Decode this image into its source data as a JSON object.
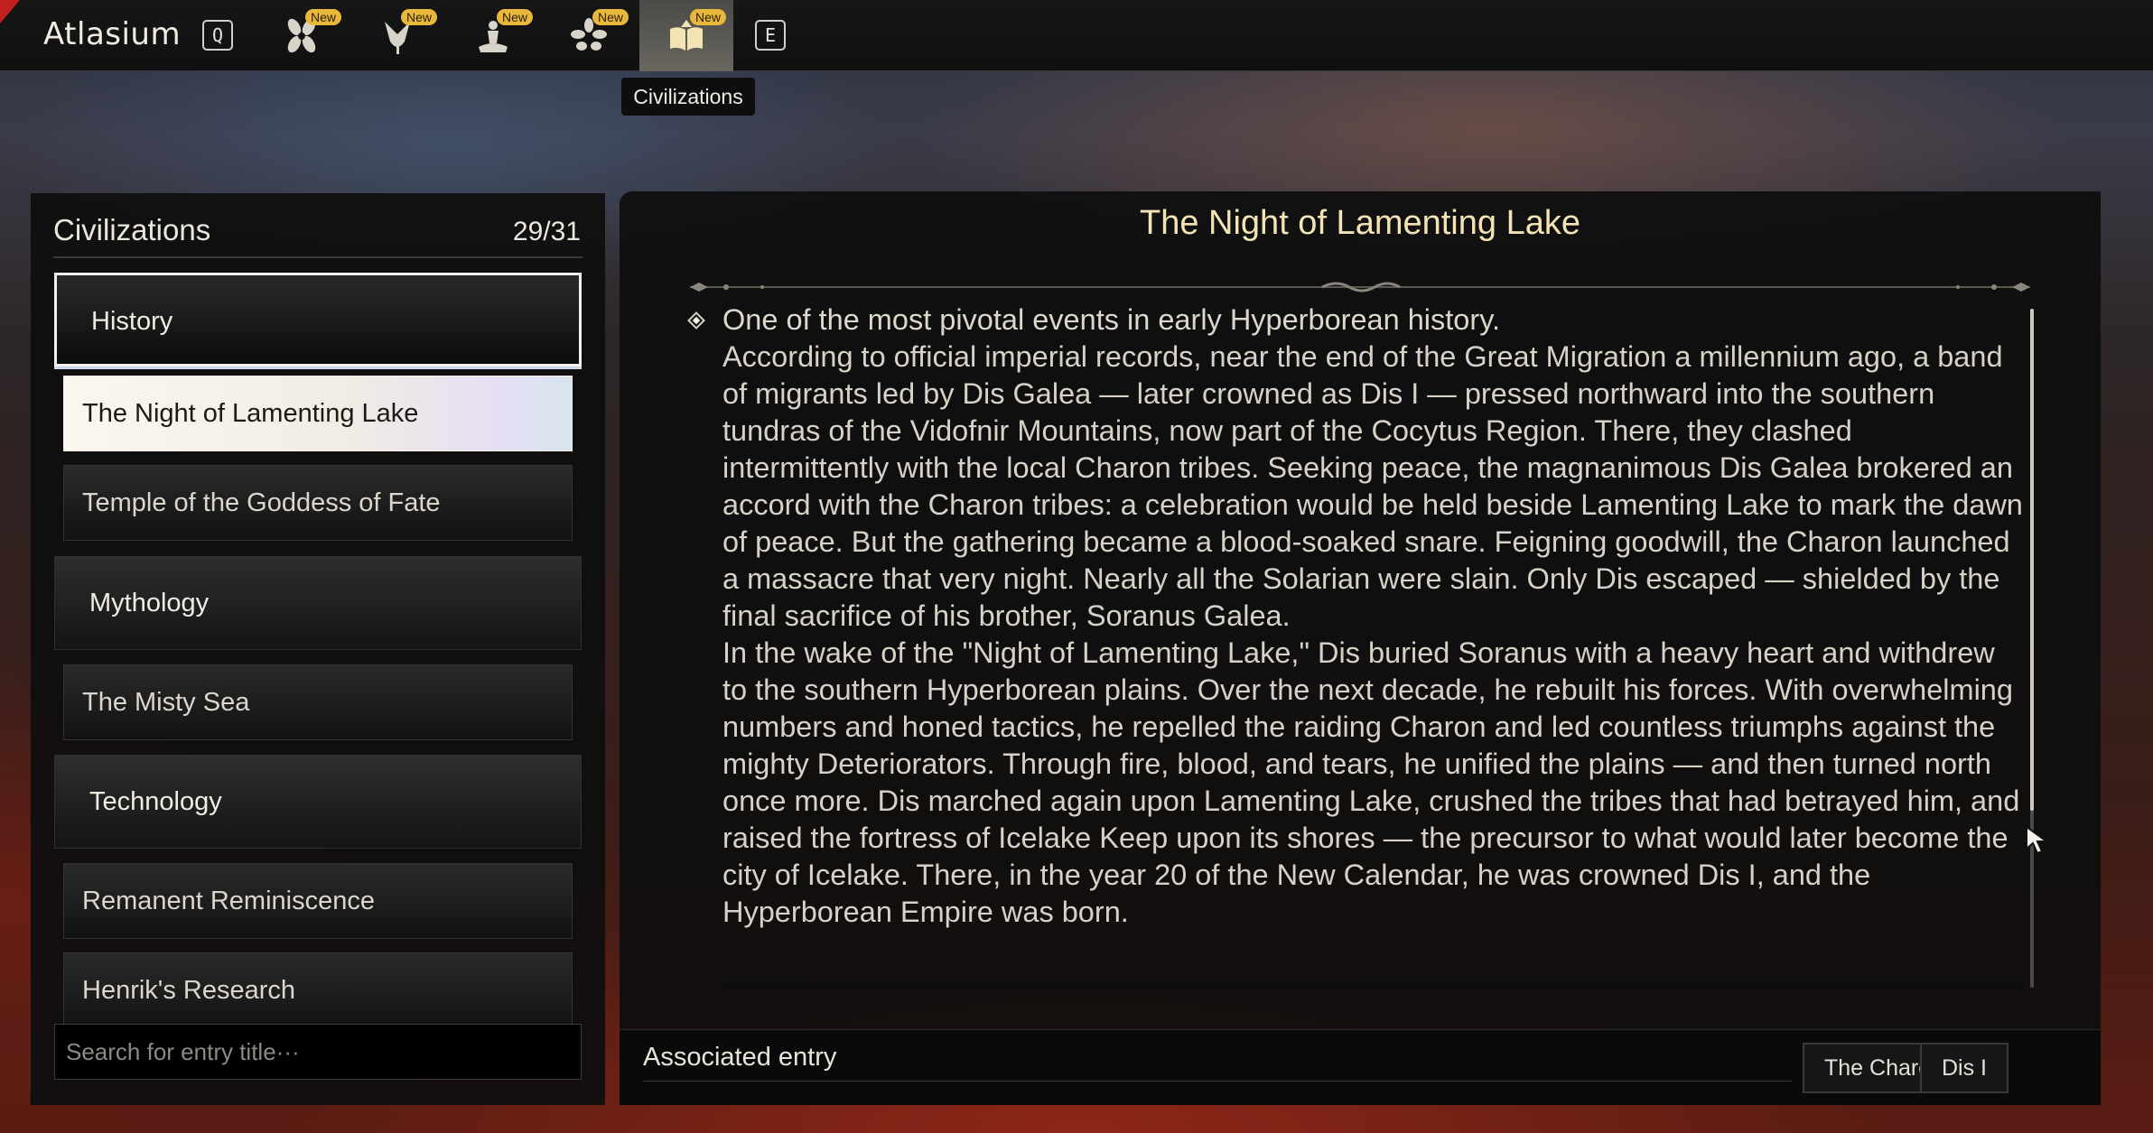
{
  "app": {
    "title": "Atlasium"
  },
  "topbar": {
    "key_prev": "Q",
    "key_next": "E",
    "tabs": [
      {
        "icon": "flower-icon",
        "badge": "New",
        "active": false
      },
      {
        "icon": "tulip-icon",
        "badge": "New",
        "active": false
      },
      {
        "icon": "statue-icon",
        "badge": "New",
        "active": false
      },
      {
        "icon": "leaf-cluster-icon",
        "badge": "New",
        "active": false
      },
      {
        "icon": "open-book-icon",
        "badge": "New",
        "active": true
      }
    ],
    "tooltip": "Civilizations"
  },
  "sidebar": {
    "title": "Civilizations",
    "count": "29/31",
    "items": [
      {
        "kind": "category",
        "label": "History",
        "open": true
      },
      {
        "kind": "entry",
        "label": "The Night of Lamenting Lake",
        "selected": true
      },
      {
        "kind": "entry",
        "label": "Temple of the Goddess of Fate"
      },
      {
        "kind": "category",
        "label": "Mythology"
      },
      {
        "kind": "entry",
        "label": "The Misty Sea"
      },
      {
        "kind": "category",
        "label": "Technology"
      },
      {
        "kind": "entry",
        "label": "Remanent Reminiscence"
      },
      {
        "kind": "entry",
        "label": "Henrik's Research"
      }
    ],
    "search_placeholder": "Search for entry title···"
  },
  "article": {
    "title": "The Night of Lamenting Lake",
    "paragraphs": [
      "One of the most pivotal events in early Hyperborean history.",
      "According to official imperial records, near the end of the Great Migration a millennium ago, a band of migrants led by Dis Galea — later crowned as Dis I — pressed northward into the southern tundras of the Vidofnir Mountains, now part of the Cocytus Region. There, they clashed intermittently with the local Charon tribes. Seeking peace, the magnanimous Dis Galea brokered an accord with the Charon tribes: a celebration would be held beside Lamenting Lake to mark the dawn of peace. But the gathering became a blood-soaked snare. Feigning goodwill, the Charon launched a massacre that very night. Nearly all the Solarian were slain. Only Dis escaped — shielded by the final sacrifice of his brother, Soranus Galea.",
      "In the wake of the \"Night of Lamenting Lake,\" Dis buried Soranus with a heavy heart and withdrew to the southern Hyperborean plains. Over the next decade, he rebuilt his forces. With overwhelming numbers and honed tactics, he repelled the raiding Charon and led countless triumphs against the mighty Deteriorators. Through fire, blood, and tears, he unified the plains — and then turned north once more. Dis marched again upon Lamenting Lake, crushed the tribes that had betrayed him, and raised the fortress of Icelake Keep upon its shores — the precursor to what would later become the city of Icelake. There, in the year 20 of the New Calendar, he was crowned Dis I, and the Hyperborean Empire was born."
    ],
    "scroll_position": 0.74
  },
  "footer": {
    "label": "Associated entry",
    "links": [
      "The Charon",
      "Dis I"
    ]
  },
  "colors": {
    "title_gold": "#f4e3b4",
    "badge": "#e8b83c",
    "selected_entry": "#f1ece4"
  }
}
